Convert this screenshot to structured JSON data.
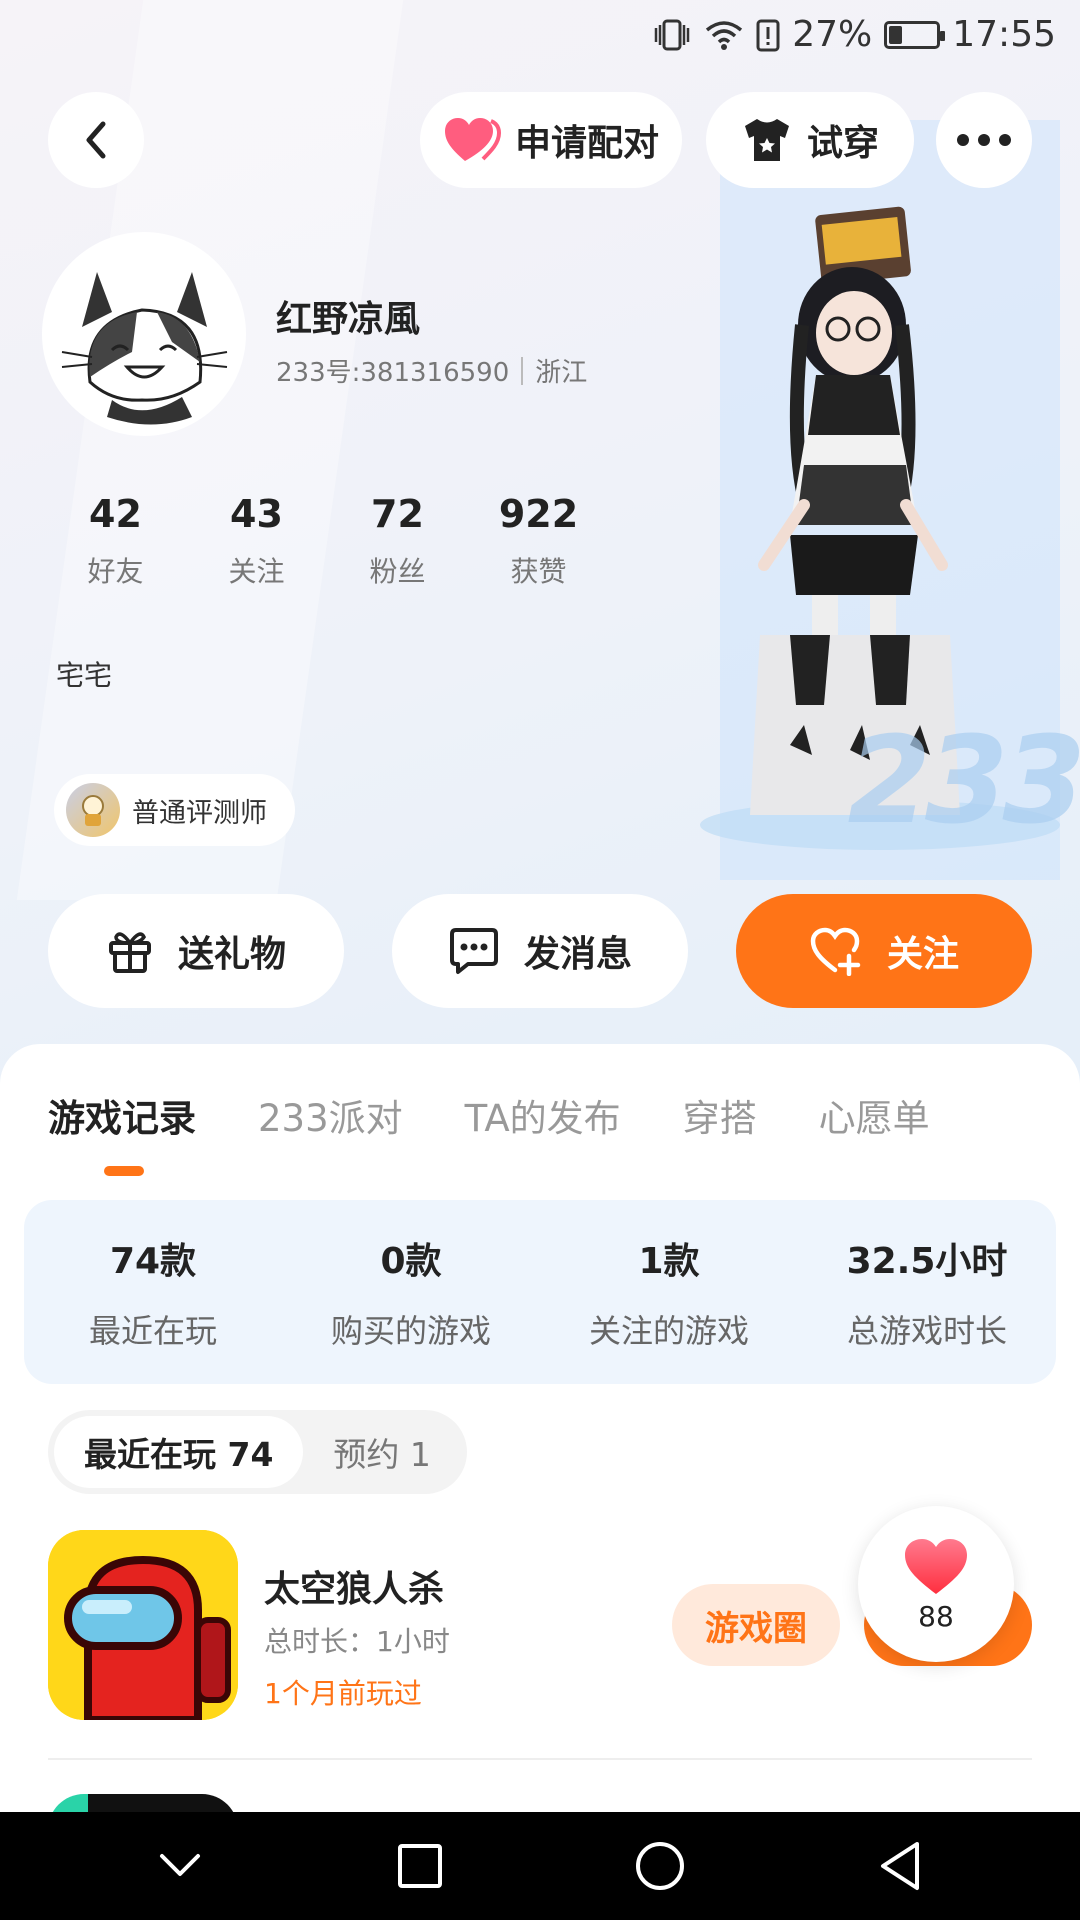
{
  "status_bar": {
    "battery_percent": "27%",
    "battery_level": 0.27,
    "time": "17:55"
  },
  "top_actions": {
    "pair_label": "申请配对",
    "try_on_label": "试穿"
  },
  "profile": {
    "name": "红野凉風",
    "uid": "233号:381316590",
    "location": "浙江",
    "stats": [
      {
        "value": "42",
        "label": "好友"
      },
      {
        "value": "43",
        "label": "关注"
      },
      {
        "value": "72",
        "label": "粉丝"
      },
      {
        "value": "922",
        "label": "获赞"
      }
    ],
    "bio": "宅宅",
    "badge": "普通评测师",
    "watermark": "233"
  },
  "actions": {
    "gift": "送礼物",
    "message": "发消息",
    "follow": "关注"
  },
  "tabs": [
    {
      "label": "游戏记录",
      "active": true
    },
    {
      "label": "233派对",
      "active": false
    },
    {
      "label": "TA的发布",
      "active": false
    },
    {
      "label": "穿搭",
      "active": false
    },
    {
      "label": "心愿单",
      "active": false
    }
  ],
  "summary": [
    {
      "value": "74款",
      "label": "最近在玩"
    },
    {
      "value": "0款",
      "label": "购买的游戏"
    },
    {
      "value": "1款",
      "label": "关注的游戏"
    },
    {
      "value": "32.5小时",
      "label": "总游戏时长"
    }
  ],
  "segments": {
    "recent": "最近在玩 74",
    "reserve": "预约 1"
  },
  "games": [
    {
      "title": "太空狼人杀",
      "duration": "总时长：1小时",
      "last_played": "1个月前玩过",
      "circle_label": "游戏圈"
    }
  ],
  "like_float": {
    "count": "88"
  },
  "colors": {
    "accent": "#ff7417",
    "summary_bg": "#eef5fd",
    "pink": "#ff4f78"
  }
}
